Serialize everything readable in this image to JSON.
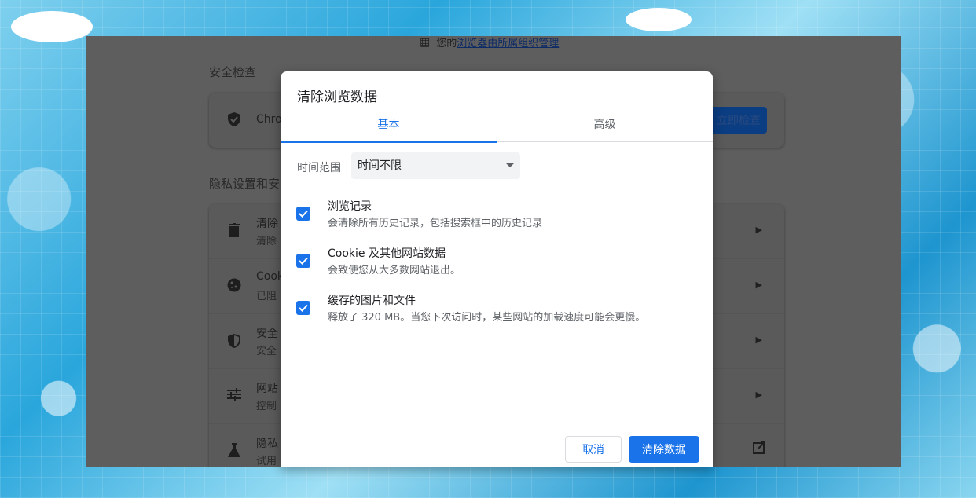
{
  "background_page": {
    "managed_notice": {
      "prefix": "您的",
      "link": "浏览器由所属组织管理"
    },
    "safety_check": {
      "heading": "安全检查",
      "row_text": "Chro",
      "button": "立即检查"
    },
    "privacy": {
      "heading": "隐私设置和安",
      "rows": [
        {
          "t1": "清除",
          "t2": "清除",
          "icon": "trash-icon",
          "action": "arrow"
        },
        {
          "t1": "Cook",
          "t2": "已阻",
          "icon": "cookie-icon",
          "action": "arrow"
        },
        {
          "t1": "安全",
          "t2": "安全",
          "icon": "shield-icon",
          "action": "arrow"
        },
        {
          "t1": "网站",
          "t2": "控制",
          "icon": "sliders-icon",
          "action": "arrow"
        },
        {
          "t1": "隐私",
          "t2": "试用",
          "icon": "flask-icon",
          "action": "external"
        }
      ]
    }
  },
  "dialog": {
    "title": "清除浏览数据",
    "tabs": [
      {
        "label": "基本",
        "active": true
      },
      {
        "label": "高级",
        "active": false
      }
    ],
    "time_range": {
      "label": "时间范围",
      "selected": "时间不限"
    },
    "options": [
      {
        "label": "浏览记录",
        "desc": "会清除所有历史记录，包括搜索框中的历史记录",
        "checked": true
      },
      {
        "label": "Cookie 及其他网站数据",
        "desc": "会致使您从大多数网站退出。",
        "checked": true
      },
      {
        "label": "缓存的图片和文件",
        "desc": "释放了 320 MB。当您下次访问时，某些网站的加载速度可能会更慢。",
        "checked": true
      }
    ],
    "buttons": {
      "cancel": "取消",
      "confirm": "清除数据"
    }
  },
  "colors": {
    "accent": "#1a73e8",
    "overlay": "#5e5e5e"
  }
}
